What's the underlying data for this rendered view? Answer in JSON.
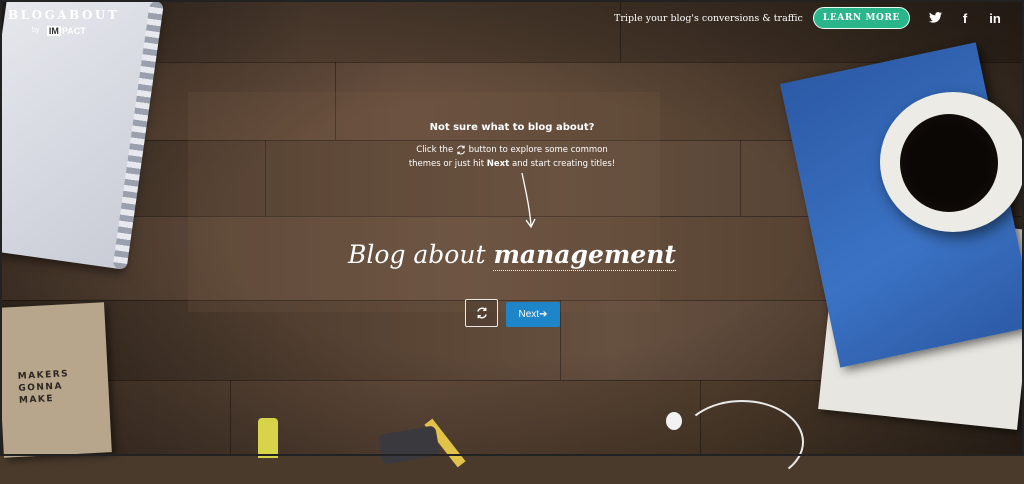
{
  "header": {
    "logo_title": "BLOGABOUT",
    "logo_by": "by",
    "logo_brand_box": "IM",
    "logo_brand_rest": "PACT",
    "tagline": "Triple your blog's conversions & traffic",
    "cta_label": "LEARN MORE",
    "social": [
      {
        "icon": "twitter-icon",
        "glyph": "𝕋"
      },
      {
        "icon": "facebook-icon",
        "glyph": "f"
      },
      {
        "icon": "linkedin-icon",
        "glyph": "in"
      }
    ]
  },
  "main": {
    "question": "Not sure what to blog about?",
    "instruction_pre": "Click the",
    "instruction_mid": "button to explore some common themes or just hit",
    "instruction_bold": "Next",
    "instruction_post": "and start creating titles!",
    "heading_prefix": "Blog about",
    "topic": "management",
    "refresh_icon": "refresh-icon",
    "next_label": "Next➔"
  },
  "decor": {
    "notebook_text": "MAKERS\nGONNA\nMAKE"
  },
  "colors": {
    "accent_green": "#2bb58a",
    "next_blue": "#1e86c8",
    "wood": "#4a3a2c"
  }
}
